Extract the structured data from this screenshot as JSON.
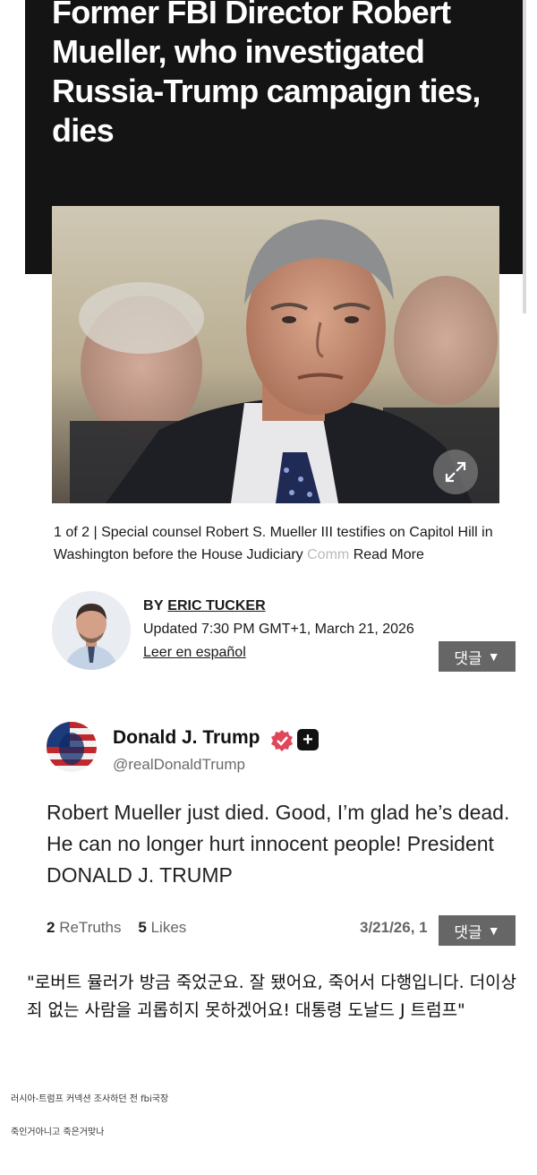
{
  "article": {
    "headline": "Former FBI Director Robert Mueller, who investigated Russia-Trump campaign ties, dies",
    "caption_counter": "1 of 2 |",
    "caption_text": "Special counsel Robert S. Mueller III testifies on Capitol Hill in Washington before the House Judiciary",
    "caption_fade": "Comm",
    "read_more": "Read More",
    "byline_by": "BY",
    "author": "ERIC TUCKER",
    "updated": "Updated 7:30 PM GMT+1, March 21, 2026",
    "spanish_link": "Leer en español",
    "expand_icon": "expand-arrows-icon"
  },
  "comment_button": {
    "label": "댓글",
    "arrow": "▼"
  },
  "post": {
    "name": "Donald J. Trump",
    "handle": "@realDonaldTrump",
    "text": "Robert Mueller just died. Good, I’m glad he’s dead. He can no longer hurt innocent people! President DONALD J. TRUMP",
    "retruths_count": "2",
    "retruths_label": "ReTruths",
    "likes_count": "5",
    "likes_label": "Likes",
    "date": "3/21/26, 1",
    "verified_color": "#e1465a"
  },
  "translation": "\"로버트 뮬러가 방금 죽었군요. 잘 됐어요, 죽어서 다행입니다. 더이상 죄 없는 사람을 괴롭히지 못하겠어요! 대통령 도날드 J 트럼프\"",
  "notes": [
    "러시아-트럼프 커넥션 조사하던 전 fbi국장",
    "죽인거아니고 죽은거맞나"
  ]
}
